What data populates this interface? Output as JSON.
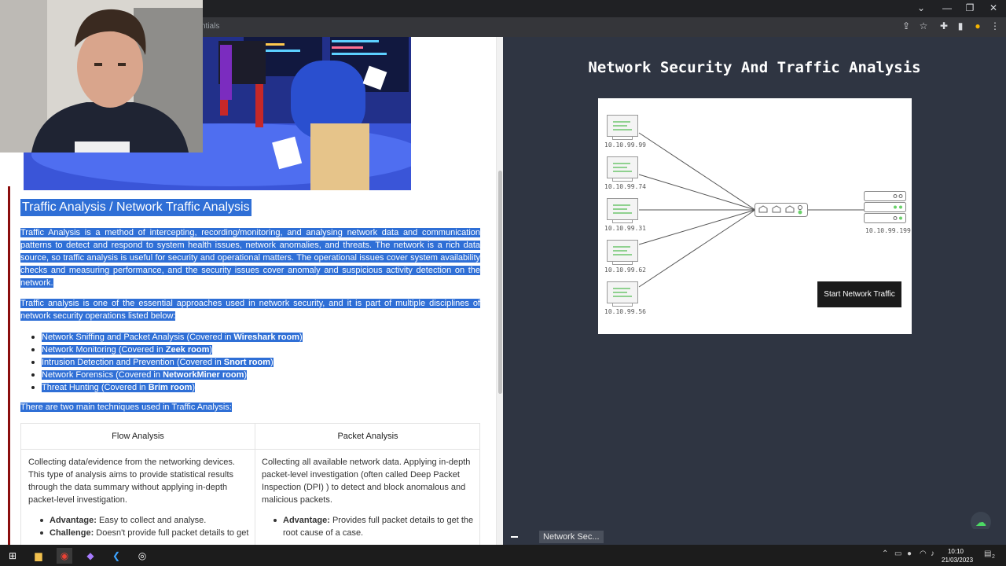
{
  "browser": {
    "tab_partial": "ntials",
    "window_controls": [
      "chevron-down-icon",
      "minimize-icon",
      "restore-icon",
      "close-icon"
    ],
    "toolbar_icons": [
      "share-icon",
      "star-icon",
      "extensions-icon",
      "sidepanel-icon",
      "profile-icon",
      "menu-icon"
    ]
  },
  "article": {
    "title": "Traffic Analysis / Network Traffic Analysis",
    "p1": "Traffic Analysis is a method of intercepting, recording/monitoring, and analysing network data and communication patterns to detect and respond to system health issues, network anomalies, and threats. The network is a rich data source, so traffic analysis is useful for security and operational matters. The operational issues cover system availability checks and measuring performance, and the security issues cover anomaly and suspicious activity detection on the network.",
    "p2": "Traffic analysis is one of the essential approaches used in network security, and it is part of multiple disciplines of network security operations listed below:",
    "list": [
      {
        "text": "Network Sniffing and Packet Analysis (Covered in ",
        "bold": "Wireshark room",
        "end": ")"
      },
      {
        "text": "Network Monitoring (Covered in ",
        "bold": "Zeek room",
        "end": ")"
      },
      {
        "text": "Intrusion Detection and Prevention (Covered in ",
        "bold": "Snort room",
        "end": ")"
      },
      {
        "text": "Network Forensics (Covered in ",
        "bold": "NetworkMiner room",
        "end": ")"
      },
      {
        "text": "Threat Hunting (Covered in ",
        "bold": "Brim room",
        "end": ")"
      }
    ],
    "p3": "There are two main techniques used in Traffic Analysis:",
    "table": {
      "col1_header": "Flow Analysis",
      "col2_header": "Packet Analysis",
      "col1_desc": "Collecting data/evidence from the networking devices. This type of analysis aims to provide statistical results through the data summary without applying in-depth packet-level investigation.",
      "col2_desc": "Collecting all available network data. Applying in-depth packet-level investigation (often called Deep Packet Inspection (DPI) ) to detect and block anomalous and malicious packets.",
      "col1_adv_label": "Advantage:",
      "col1_adv": " Easy to collect and analyse.",
      "col1_chal_label": "Challenge:",
      "col1_chal": " Doesn't provide full packet details to get",
      "col2_adv_label": "Advantage:",
      "col2_adv": " Provides full packet details to get the root cause of a case."
    }
  },
  "sim": {
    "title": "Network Security And Traffic Analysis",
    "hosts": [
      "10.10.99.99",
      "10.10.99.74",
      "10.10.99.31",
      "10.10.99.62",
      "10.10.99.56"
    ],
    "server_ip": "10.10.99.199",
    "start_button": "Start Network Traffic",
    "tab_chip": "Network Sec..."
  },
  "taskbar": {
    "time": "10:10",
    "date": "21/03/2023",
    "notification_count": "2",
    "apps": [
      "windows-start-icon",
      "file-explorer-icon",
      "chrome-icon",
      "visual-studio-icon",
      "vscode-icon",
      "obs-icon"
    ]
  }
}
